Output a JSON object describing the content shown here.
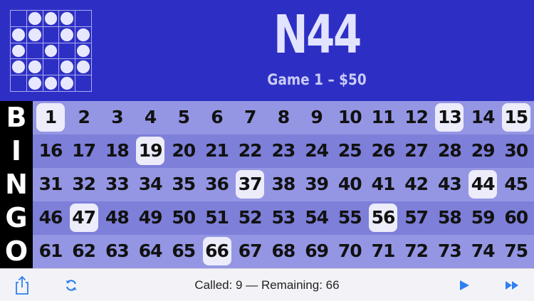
{
  "header": {
    "current_call": "N44",
    "game_info": "Game 1 – $50",
    "pattern": {
      "grid_size": 5,
      "filled": [
        [
          0,
          1,
          1,
          1,
          0
        ],
        [
          1,
          1,
          0,
          1,
          1
        ],
        [
          1,
          0,
          1,
          0,
          1
        ],
        [
          1,
          1,
          0,
          1,
          1
        ],
        [
          0,
          1,
          1,
          1,
          0
        ]
      ]
    }
  },
  "board": {
    "letters": [
      "B",
      "I",
      "N",
      "G",
      "O"
    ],
    "rows": [
      [
        1,
        2,
        3,
        4,
        5,
        6,
        7,
        8,
        9,
        10,
        11,
        12,
        13,
        14,
        15
      ],
      [
        16,
        17,
        18,
        19,
        20,
        21,
        22,
        23,
        24,
        25,
        26,
        27,
        28,
        29,
        30
      ],
      [
        31,
        32,
        33,
        34,
        35,
        36,
        37,
        38,
        39,
        40,
        41,
        42,
        43,
        44,
        45
      ],
      [
        46,
        47,
        48,
        49,
        50,
        51,
        52,
        53,
        54,
        55,
        56,
        57,
        58,
        59,
        60
      ],
      [
        61,
        62,
        63,
        64,
        65,
        66,
        67,
        68,
        69,
        70,
        71,
        72,
        73,
        74,
        75
      ]
    ],
    "called": [
      1,
      13,
      15,
      19,
      37,
      44,
      47,
      56,
      66
    ]
  },
  "toolbar": {
    "status": "Called: 9 — Remaining: 66",
    "share_icon": "share-icon",
    "refresh_icon": "refresh-icon",
    "play_icon": "play-icon",
    "fast_forward_icon": "fast-forward-icon"
  },
  "colors": {
    "header_bg": "#2d2fc4",
    "accent": "#2f7ff0"
  }
}
